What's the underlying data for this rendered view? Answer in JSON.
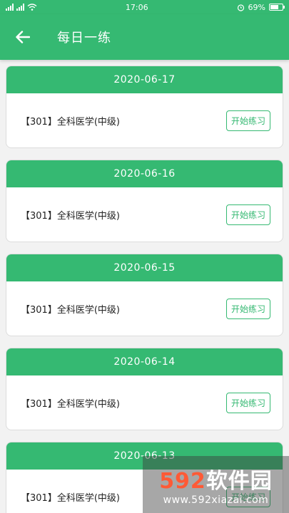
{
  "statusbar": {
    "time": "17:06",
    "battery": "69%",
    "battery_level": 0.69
  },
  "appbar": {
    "title": "每日一练"
  },
  "cards": [
    {
      "date": "2020-06-17",
      "course": "【301】全科医学(中级)",
      "button": "开始练习"
    },
    {
      "date": "2020-06-16",
      "course": "【301】全科医学(中级)",
      "button": "开始练习"
    },
    {
      "date": "2020-06-15",
      "course": "【301】全科医学(中级)",
      "button": "开始练习"
    },
    {
      "date": "2020-06-14",
      "course": "【301】全科医学(中级)",
      "button": "开始练习"
    },
    {
      "date": "2020-06-13",
      "course": "【301】全科医学(中级)",
      "button": "开始练习"
    }
  ],
  "watermark": {
    "brand_num": "592",
    "brand_text": "软件园",
    "url": "www.592xiazai.com"
  },
  "colors": {
    "primary": "#35b972"
  }
}
